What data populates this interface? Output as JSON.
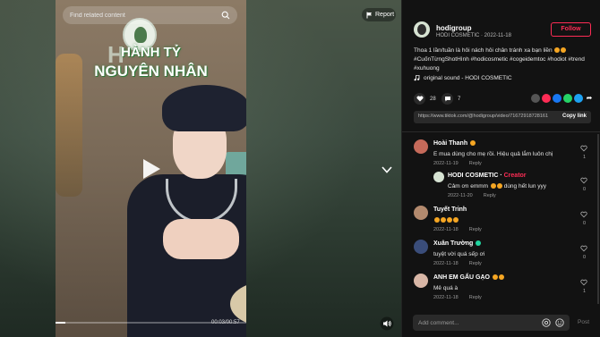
{
  "video": {
    "search_placeholder": "Find related content",
    "report_label": "Report",
    "title_line1": "HÀNH TỶ",
    "title_line2": "NGUYÊN NHÂN",
    "brand_letter": "H",
    "time": "00:03/00:57",
    "progress_fraction": 0.05
  },
  "header": {
    "username": "hodigroup",
    "subtitle": "HODI COSMETIC · 2022-11-18",
    "follow_label": "Follow"
  },
  "post": {
    "description": "Thoa 1 lần/tuần là hôi nách hôi chân tránh xa bạn liền",
    "hashtags": "#CuốnTừngShotHình #hodicosmetic #cogeidemtoc #hodiot #trend #xuhuong",
    "sound": "original sound - HODI COSMETIC",
    "likes": "28",
    "comments": "7",
    "link": "https://www.tiktok.com/@hodigroup/video/71672918728161...",
    "copy_label": "Copy link"
  },
  "comments": [
    {
      "name": "Hoài Thanh",
      "text": "E mua dùng cho mẹ rồi. Hiệu quả lắm luôn chị",
      "date": "2022-11-19",
      "reply": "Reply",
      "likes": "1",
      "avatar_color": "#c56a5a"
    },
    {
      "name": "HODI COSMETIC",
      "creator": "Creator",
      "text": "Cảm ơn emmm",
      "text2": "dùng hết lun yyy",
      "date": "2022-11-20",
      "reply": "Reply",
      "likes": "0",
      "avatar_color": "#d7e3d3"
    },
    {
      "name": "Tuyết Trinh",
      "text": "",
      "date": "2022-11-18",
      "reply": "Reply",
      "likes": "0",
      "avatar_color": "#b38a6e"
    },
    {
      "name": "Xuân Trường",
      "text": "tuyệt vời quá sếp ơi",
      "date": "2022-11-18",
      "reply": "Reply",
      "likes": "0",
      "avatar_color": "#3a4d7a"
    },
    {
      "name": "ANH EM GẤU GẠO",
      "text": "Mê quá à",
      "date": "2022-11-18",
      "reply": "Reply",
      "likes": "1",
      "avatar_color": "#d8b6a6"
    }
  ],
  "footer": {
    "comment_placeholder": "Add comment...",
    "post_label": "Post"
  },
  "colors": {
    "accent": "#fe2c55",
    "panel_bg": "#121212"
  }
}
